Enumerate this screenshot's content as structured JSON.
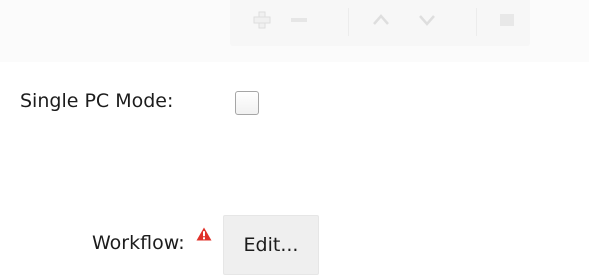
{
  "toolbar": {
    "buttons": [
      {
        "icon": "plus-icon",
        "enabled": false
      },
      {
        "icon": "minus-icon",
        "enabled": false
      },
      {
        "icon": "chevron-up-icon",
        "enabled": false
      },
      {
        "icon": "chevron-down-icon",
        "enabled": false
      },
      {
        "icon": "square-icon",
        "enabled": false
      }
    ]
  },
  "form": {
    "single_pc_mode": {
      "label": "Single PC Mode:",
      "checked": false
    },
    "workflow": {
      "label": "Workflow:",
      "warning_icon": "warning-icon",
      "warning_color": "#e0312a",
      "edit_label": "Edit..."
    }
  }
}
